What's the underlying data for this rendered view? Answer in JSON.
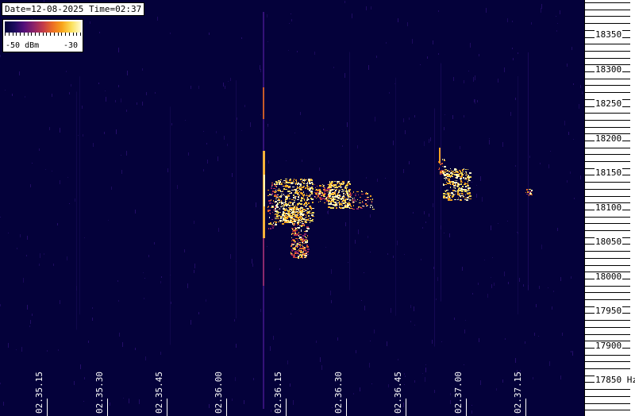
{
  "app": {
    "info_label": "Date=12-08-2025 Time=02:37",
    "legend": {
      "low_label": "-50 dBm",
      "high_label": "-30"
    }
  },
  "freq_axis": {
    "unit": "Hz",
    "labels": [
      "18350",
      "18300",
      "18250",
      "18200",
      "18150",
      "18100",
      "18050",
      "18000",
      "17950",
      "17900",
      "17850 Hz"
    ]
  },
  "time_axis": {
    "labels": [
      "02.35.15",
      "02.35.30",
      "02.35.45",
      "02.36.00",
      "02.36.15",
      "02.36.30",
      "02.36.45",
      "02.37.00",
      "02.37.15"
    ]
  },
  "colors": {
    "background": "#04013a",
    "colormap": [
      "#03013a",
      "#1b0c5e",
      "#520f7a",
      "#8a226a",
      "#c23a4a",
      "#ec6c25",
      "#f9a31a",
      "#fbe05a",
      "#fffbd0"
    ]
  }
}
